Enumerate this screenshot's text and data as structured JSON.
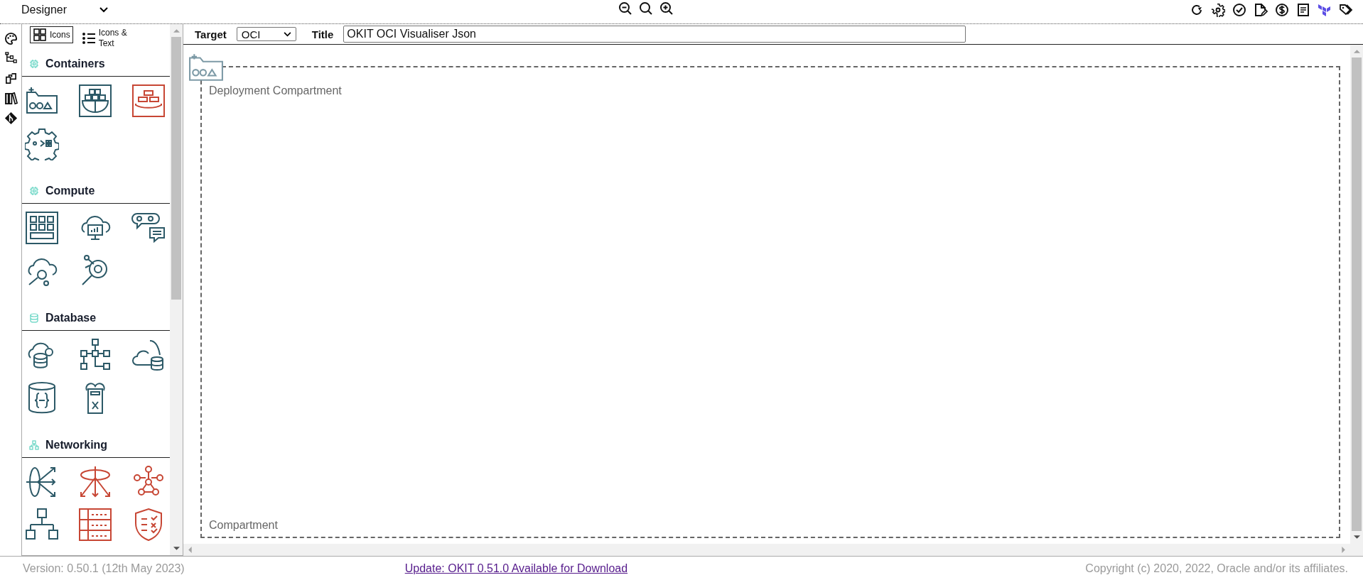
{
  "mode_select": {
    "value": "Designer"
  },
  "palette": {
    "view_options": [
      {
        "label": "Icons",
        "selected": true
      },
      {
        "label": "Icons & Text",
        "selected": false
      }
    ],
    "sections": [
      {
        "title": "Containers",
        "items": [
          {
            "color": "#2c5967"
          },
          {
            "color": "#2c5967"
          },
          {
            "color": "#c74634"
          },
          {
            "color": "#2c5967"
          }
        ]
      },
      {
        "title": "Compute",
        "items": [
          {
            "color": "#2c5967"
          },
          {
            "color": "#2c5967"
          },
          {
            "color": "#2c5967"
          },
          {
            "color": "#2c5967"
          },
          {
            "color": "#2c5967"
          }
        ]
      },
      {
        "title": "Database",
        "items": [
          {
            "color": "#2c5967"
          },
          {
            "color": "#2c5967"
          },
          {
            "color": "#2c5967"
          },
          {
            "color": "#2c5967"
          },
          {
            "color": "#2c5967"
          }
        ]
      },
      {
        "title": "Networking",
        "items": [
          {
            "color": "#2c5967"
          },
          {
            "color": "#c74634"
          },
          {
            "color": "#c74634"
          },
          {
            "color": "#2c5967"
          },
          {
            "color": "#c74634"
          },
          {
            "color": "#c74634"
          }
        ]
      }
    ]
  },
  "target": {
    "label": "Target",
    "value": "OCI"
  },
  "title_field": {
    "label": "Title",
    "value": "OKIT OCI Visualiser Json"
  },
  "canvas": {
    "compartment": {
      "name": "Deployment Compartment",
      "type_label": "Compartment"
    }
  },
  "footer": {
    "version": "Version: 0.50.1 (12th May 2023)",
    "update_link": "Update: OKIT 0.51.0 Available for Download",
    "copyright": "Copyright (c) 2020, 2022, Oracle and/or its affiliates."
  }
}
